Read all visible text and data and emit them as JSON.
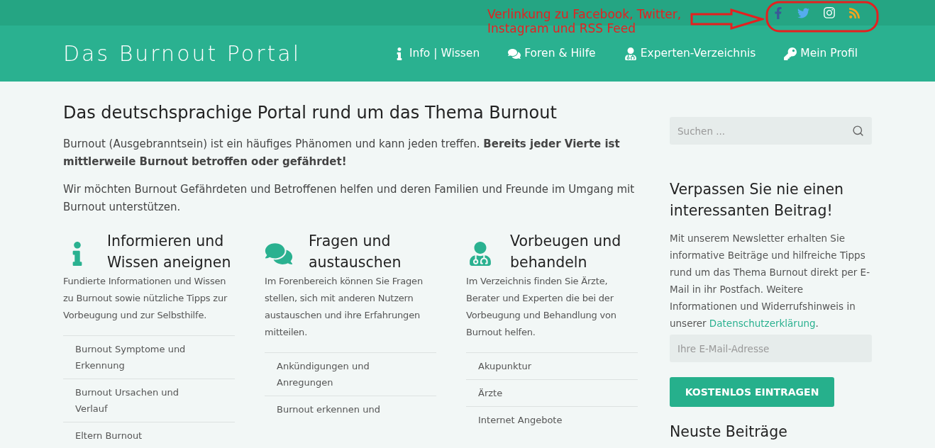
{
  "annotation": {
    "lines": [
      "Verlinkung zu Facebook, Twitter,",
      "Instagram und RSS Feed"
    ]
  },
  "social_icons": [
    {
      "kind": "facebook"
    },
    {
      "kind": "twitter"
    },
    {
      "kind": "instagram"
    },
    {
      "kind": "rss"
    }
  ],
  "header": {
    "logo": "Das Burnout Portal",
    "nav": [
      {
        "kind": "info",
        "label": "Info | Wissen"
      },
      {
        "kind": "comments",
        "label": "Foren & Hilfe"
      },
      {
        "kind": "doctor",
        "label": "Experten-Verzeichnis"
      },
      {
        "kind": "key",
        "label": "Mein Profil"
      }
    ]
  },
  "main": {
    "title": "Das deutschsprachige Portal rund um das Thema Burnout",
    "paragraphs": [
      "Burnout (Ausgebranntsein) ist ein häufiges Phänomen und kann jeden treffen. **Bereits jeder Vierte ist mittlerweile Burnout betroffen oder gefährdet!**",
      "Wir möchten Burnout Gefährdeten und Betroffenen helfen und deren Familien und Freunde im Umgang mit Burnout unterstützen."
    ],
    "columns": [
      {
        "kind": "info",
        "title": "Informieren und Wissen aneignen",
        "text": "Fundierte Informationen und Wissen zu Burnout sowie nützliche Tipps zur Vorbeugung und zur Selbsthilfe.",
        "links": [
          "Burnout Symptome und Erkennung",
          "Burnout Ursachen und Verlauf",
          "Eltern Burnout"
        ]
      },
      {
        "kind": "comments",
        "title": "Fragen und austauschen",
        "text": "Im Forenbereich können Sie Fragen stellen, sich mit anderen Nutzern austauschen und ihre Erfahrungen mitteilen.",
        "links": [
          "Ankündigungen und Anregungen",
          "Burnout erkennen und"
        ]
      },
      {
        "kind": "doctor",
        "title": "Vorbeugen und behandeln",
        "text": "Im Verzeichnis finden Sie Ärzte, Berater und Experten die bei der Vorbeugung und Behandlung von Burnout helfen.",
        "links": [
          "Akupunktur",
          "Ärzte",
          "Internet Angebote"
        ]
      }
    ]
  },
  "sidebar": {
    "search": {
      "placeholder": "Suchen ..."
    },
    "newsletter": {
      "title": "Verpassen Sie nie einen interessanten Beitrag!",
      "text": "Mit unserem Newsletter erhalten Sie informative Beiträge und hilfreiche Tipps rund um das Thema Burnout direkt per E-Mail in ihr Postfach. Weitere Informationen und Widerrufshinweis in unserer",
      "link": "Datenschutzerklärung",
      "text_after": ".",
      "email_placeholder": "Ihre E-Mail-Adresse",
      "button": "KOSTENLOS EINTRAGEN"
    },
    "next_heading": "Neuste Beiträge"
  }
}
